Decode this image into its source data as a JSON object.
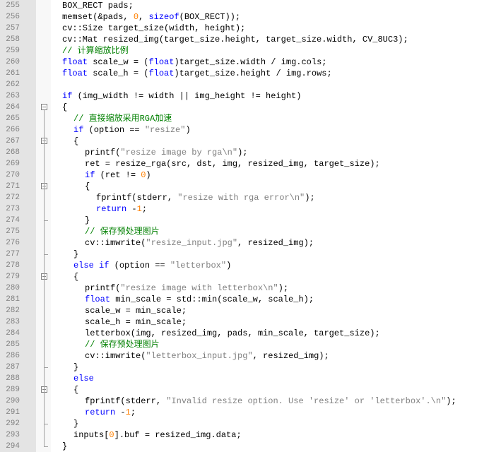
{
  "editor": {
    "lines": [
      {
        "n": "255",
        "indent": 0,
        "fold": "",
        "t": [
          [
            "p",
            "BOX_RECT pads;"
          ]
        ]
      },
      {
        "n": "256",
        "indent": 0,
        "fold": "",
        "t": [
          [
            "p",
            "memset(&pads, "
          ],
          [
            "n",
            "0"
          ],
          [
            "p",
            ", "
          ],
          [
            "k",
            "sizeof"
          ],
          [
            "p",
            "(BOX_RECT));"
          ]
        ]
      },
      {
        "n": "257",
        "indent": 0,
        "fold": "",
        "t": [
          [
            "p",
            "cv::Size target_size(width, height);"
          ]
        ]
      },
      {
        "n": "258",
        "indent": 0,
        "fold": "",
        "t": [
          [
            "p",
            "cv::Mat resized_img(target_size.height, target_size.width, CV_8UC3);"
          ]
        ]
      },
      {
        "n": "259",
        "indent": 0,
        "fold": "",
        "t": [
          [
            "c",
            "// 计算缩放比例"
          ]
        ]
      },
      {
        "n": "260",
        "indent": 0,
        "fold": "",
        "t": [
          [
            "k",
            "float"
          ],
          [
            "p",
            " scale_w = ("
          ],
          [
            "k",
            "float"
          ],
          [
            "p",
            ")target_size.width / img.cols;"
          ]
        ]
      },
      {
        "n": "261",
        "indent": 0,
        "fold": "",
        "t": [
          [
            "k",
            "float"
          ],
          [
            "p",
            " scale_h = ("
          ],
          [
            "k",
            "float"
          ],
          [
            "p",
            ")target_size.height / img.rows;"
          ]
        ]
      },
      {
        "n": "262",
        "indent": 0,
        "fold": "",
        "t": []
      },
      {
        "n": "263",
        "indent": 0,
        "fold": "",
        "t": [
          [
            "k",
            "if"
          ],
          [
            "p",
            " (img_width != width || img_height != height)"
          ]
        ]
      },
      {
        "n": "264",
        "indent": 0,
        "fold": "open",
        "t": [
          [
            "p",
            "{"
          ]
        ]
      },
      {
        "n": "265",
        "indent": 1,
        "fold": "",
        "t": [
          [
            "c",
            "// 直接缩放采用RGA加速"
          ]
        ]
      },
      {
        "n": "266",
        "indent": 1,
        "fold": "",
        "t": [
          [
            "k",
            "if"
          ],
          [
            "p",
            " (option == "
          ],
          [
            "s",
            "\"resize\""
          ],
          [
            "p",
            ")"
          ]
        ]
      },
      {
        "n": "267",
        "indent": 1,
        "fold": "open",
        "t": [
          [
            "p",
            "{"
          ]
        ]
      },
      {
        "n": "268",
        "indent": 2,
        "fold": "",
        "t": [
          [
            "p",
            "printf("
          ],
          [
            "s",
            "\"resize image by rga\\n\""
          ],
          [
            "p",
            ");"
          ]
        ]
      },
      {
        "n": "269",
        "indent": 2,
        "fold": "",
        "t": [
          [
            "p",
            "ret = resize_rga(src, dst, img, resized_img, target_size);"
          ]
        ]
      },
      {
        "n": "270",
        "indent": 2,
        "fold": "",
        "t": [
          [
            "k",
            "if"
          ],
          [
            "p",
            " (ret != "
          ],
          [
            "n",
            "0"
          ],
          [
            "p",
            ")"
          ]
        ]
      },
      {
        "n": "271",
        "indent": 2,
        "fold": "open",
        "t": [
          [
            "p",
            "{"
          ]
        ]
      },
      {
        "n": "272",
        "indent": 3,
        "fold": "",
        "t": [
          [
            "p",
            "fprintf(stderr, "
          ],
          [
            "s",
            "\"resize with rga error\\n\""
          ],
          [
            "p",
            ");"
          ]
        ]
      },
      {
        "n": "273",
        "indent": 3,
        "fold": "",
        "t": [
          [
            "k",
            "return"
          ],
          [
            "p",
            " -"
          ],
          [
            "n",
            "1"
          ],
          [
            "p",
            ";"
          ]
        ]
      },
      {
        "n": "274",
        "indent": 2,
        "fold": "end",
        "t": [
          [
            "p",
            "}"
          ]
        ]
      },
      {
        "n": "275",
        "indent": 2,
        "fold": "",
        "t": [
          [
            "c",
            "// 保存预处理图片"
          ]
        ]
      },
      {
        "n": "276",
        "indent": 2,
        "fold": "",
        "t": [
          [
            "p",
            "cv::imwrite("
          ],
          [
            "s",
            "\"resize_input.jpg\""
          ],
          [
            "p",
            ", resized_img);"
          ]
        ]
      },
      {
        "n": "277",
        "indent": 1,
        "fold": "end",
        "t": [
          [
            "p",
            "}"
          ]
        ]
      },
      {
        "n": "278",
        "indent": 1,
        "fold": "",
        "t": [
          [
            "k",
            "else if"
          ],
          [
            "p",
            " (option == "
          ],
          [
            "s",
            "\"letterbox\""
          ],
          [
            "p",
            ")"
          ]
        ]
      },
      {
        "n": "279",
        "indent": 1,
        "fold": "open",
        "t": [
          [
            "p",
            "{"
          ]
        ]
      },
      {
        "n": "280",
        "indent": 2,
        "fold": "",
        "t": [
          [
            "p",
            "printf("
          ],
          [
            "s",
            "\"resize image with letterbox\\n\""
          ],
          [
            "p",
            ");"
          ]
        ]
      },
      {
        "n": "281",
        "indent": 2,
        "fold": "",
        "t": [
          [
            "k",
            "float"
          ],
          [
            "p",
            " min_scale = std::min(scale_w, scale_h);"
          ]
        ]
      },
      {
        "n": "282",
        "indent": 2,
        "fold": "",
        "t": [
          [
            "p",
            "scale_w = min_scale;"
          ]
        ]
      },
      {
        "n": "283",
        "indent": 2,
        "fold": "",
        "t": [
          [
            "p",
            "scale_h = min_scale;"
          ]
        ]
      },
      {
        "n": "284",
        "indent": 2,
        "fold": "",
        "t": [
          [
            "p",
            "letterbox(img, resized_img, pads, min_scale, target_size);"
          ]
        ]
      },
      {
        "n": "285",
        "indent": 2,
        "fold": "",
        "t": [
          [
            "c",
            "// 保存预处理图片"
          ]
        ]
      },
      {
        "n": "286",
        "indent": 2,
        "fold": "",
        "t": [
          [
            "p",
            "cv::imwrite("
          ],
          [
            "s",
            "\"letterbox_input.jpg\""
          ],
          [
            "p",
            ", resized_img);"
          ]
        ]
      },
      {
        "n": "287",
        "indent": 1,
        "fold": "end",
        "t": [
          [
            "p",
            "}"
          ]
        ]
      },
      {
        "n": "288",
        "indent": 1,
        "fold": "",
        "t": [
          [
            "k",
            "else"
          ]
        ]
      },
      {
        "n": "289",
        "indent": 1,
        "fold": "open",
        "t": [
          [
            "p",
            "{"
          ]
        ]
      },
      {
        "n": "290",
        "indent": 2,
        "fold": "",
        "t": [
          [
            "p",
            "fprintf(stderr, "
          ],
          [
            "s",
            "\"Invalid resize option. Use 'resize' or 'letterbox'.\\n\""
          ],
          [
            "p",
            ");"
          ]
        ]
      },
      {
        "n": "291",
        "indent": 2,
        "fold": "",
        "t": [
          [
            "k",
            "return"
          ],
          [
            "p",
            " -"
          ],
          [
            "n",
            "1"
          ],
          [
            "p",
            ";"
          ]
        ]
      },
      {
        "n": "292",
        "indent": 1,
        "fold": "end",
        "t": [
          [
            "p",
            "}"
          ]
        ]
      },
      {
        "n": "293",
        "indent": 1,
        "fold": "",
        "t": [
          [
            "p",
            "inputs["
          ],
          [
            "n",
            "0"
          ],
          [
            "p",
            "].buf = resized_img.data;"
          ]
        ]
      },
      {
        "n": "294",
        "indent": 0,
        "fold": "end",
        "t": [
          [
            "p",
            "}"
          ]
        ]
      }
    ]
  },
  "colors": {
    "keyword": "#0000ff",
    "number": "#ff8000",
    "string": "#808080",
    "comment": "#008000",
    "plain": "#000000",
    "gutter": "#e4e4e4",
    "line_number": "#808080"
  }
}
